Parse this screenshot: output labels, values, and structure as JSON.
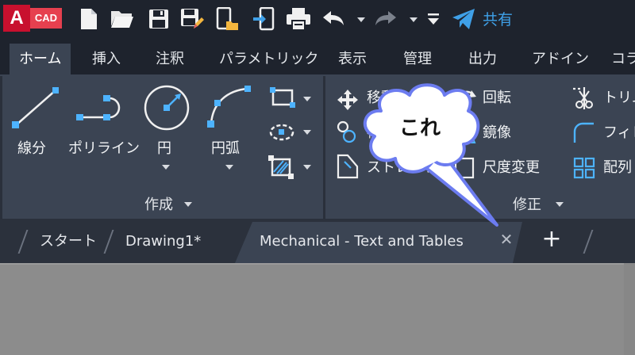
{
  "app": {
    "logo_letter": "A",
    "logo_suffix": "CAD",
    "share_label": "共有"
  },
  "quick_access": [
    {
      "icon": "new-file-icon"
    },
    {
      "icon": "open-folder-icon"
    },
    {
      "icon": "save-icon"
    },
    {
      "icon": "save-as-icon"
    },
    {
      "icon": "open-from-mobile-icon"
    },
    {
      "icon": "save-to-mobile-icon"
    },
    {
      "icon": "print-icon"
    },
    {
      "icon": "undo-icon"
    },
    {
      "icon": "redo-icon"
    },
    {
      "icon": "customize-toolbar-icon"
    },
    {
      "icon": "share-icon"
    }
  ],
  "ribbon_tabs": [
    "ホーム",
    "挿入",
    "注釈",
    "パラメトリック",
    "表示",
    "管理",
    "出力",
    "アドイン",
    "コラ"
  ],
  "draw_panel": {
    "title": "作成",
    "tools": [
      "線分",
      "ポリライン",
      "円",
      "円弧"
    ]
  },
  "modify_panel": {
    "title": "修正",
    "tools": [
      "移動",
      "複写",
      "ストレッチ",
      "回転",
      "鏡像",
      "尺度変更",
      "トリム",
      "フィレ",
      "配列"
    ]
  },
  "file_tabs": {
    "items": [
      "スタート",
      "Drawing1*",
      "Mechanical - Text and Tables"
    ],
    "close_glyph": "✕",
    "new_glyph": "+"
  },
  "annotation": {
    "text": "これ"
  },
  "colors": {
    "titlebar": "#1e232d",
    "ribbon": "#3b4453",
    "accent_blue": "#3fa0e8",
    "grip_blue": "#4db3ff",
    "logo_red": "#c8102e"
  }
}
